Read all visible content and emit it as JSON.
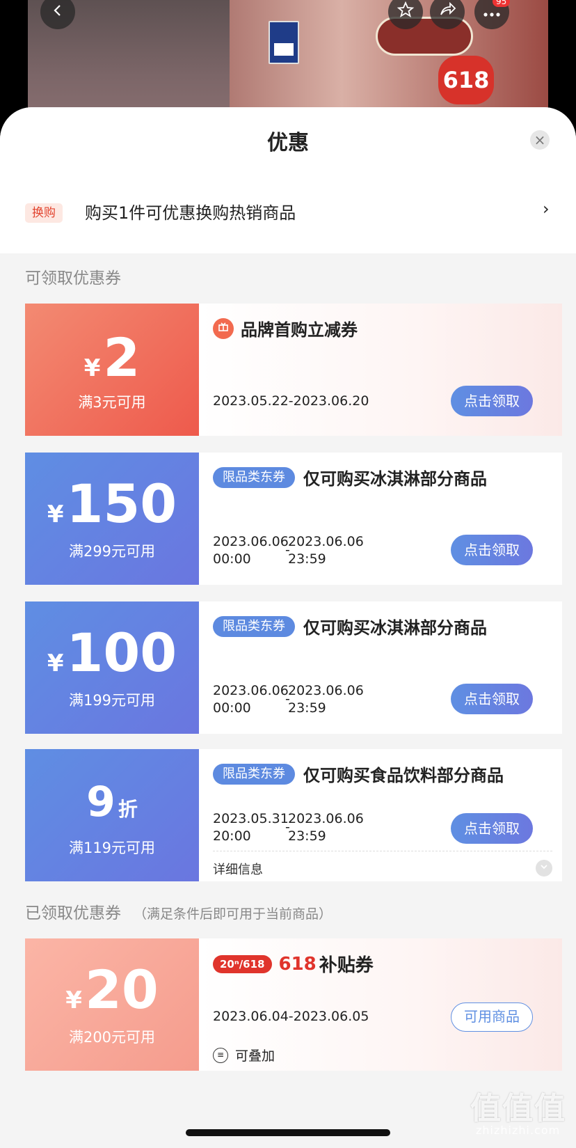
{
  "header": {
    "title": "优惠",
    "product_badge": "618",
    "more_badge": "95"
  },
  "exchange": {
    "tag": "换购",
    "text": "购买1件可优惠换购热销商品",
    "arrow": "›"
  },
  "sections": {
    "available": "可领取优惠券",
    "claimed": "已领取优惠券",
    "claimed_note": "（满足条件后即可用于当前商品）"
  },
  "coupons": [
    {
      "yen": "¥",
      "amount": "2",
      "condition": "满3元可用",
      "title": "品牌首购立减券",
      "date": "2023.05.22-2023.06.20",
      "button": "点击领取"
    },
    {
      "yen": "¥",
      "amount": "150",
      "condition": "满299元可用",
      "tag": "限品类东券",
      "title": "仅可购买冰淇淋部分商品",
      "start_date": "2023.06.06",
      "start_time": "00:00",
      "dash": "-",
      "end_date": "2023.06.06",
      "end_time": "23:59",
      "button": "点击领取"
    },
    {
      "yen": "¥",
      "amount": "100",
      "condition": "满199元可用",
      "tag": "限品类东券",
      "title": "仅可购买冰淇淋部分商品",
      "start_date": "2023.06.06",
      "start_time": "00:00",
      "dash": "-",
      "end_date": "2023.06.06",
      "end_time": "23:59",
      "button": "点击领取"
    },
    {
      "amount": "9",
      "unit": "折",
      "condition": "满119元可用",
      "tag": "限品类东券",
      "title": "仅可购买食品饮料部分商品",
      "start_date": "2023.05.31",
      "start_time": "20:00",
      "dash": "-",
      "end_date": "2023.06.06",
      "end_time": "23:59",
      "button": "点击领取",
      "detail": "详细信息"
    }
  ],
  "claimed_coupon": {
    "yen": "¥",
    "amount": "20",
    "condition": "满200元可用",
    "badge": "20ⁿ/618",
    "brand": "618",
    "title": "补贴券",
    "date": "2023.06.04-2023.06.05",
    "button": "可用商品",
    "stack": "可叠加"
  },
  "watermark": {
    "main": "值值值",
    "sub": "zhizhizhi.com"
  },
  "colors": {
    "accent_blue": "#5f8fe2",
    "accent_red": "#e0342c",
    "coupon_red": "#ee5a4c"
  },
  "icons": [
    "back-icon",
    "star-icon",
    "share-icon",
    "more-icon",
    "close-icon",
    "chevron-right-icon",
    "gift-icon",
    "chevron-down-icon",
    "stack-icon"
  ]
}
